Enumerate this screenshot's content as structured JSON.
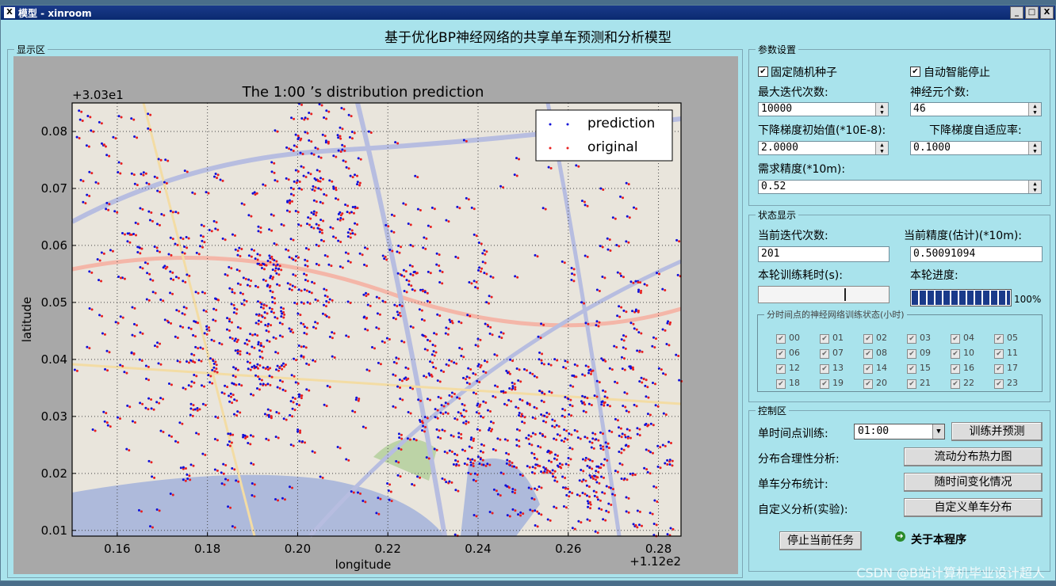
{
  "window": {
    "title": "模型 - xinroom",
    "app_heading": "基于优化BP神经网络的共享单车预测和分析模型",
    "controls": [
      "_",
      "□",
      "X"
    ]
  },
  "display_area": {
    "label": "显示区"
  },
  "chart_data": {
    "type": "scatter",
    "title": "The 1:00 ’s distribution prediction",
    "xlabel": "longitude",
    "ylabel": "latitude",
    "x_offset_label": "+1.12e2",
    "y_offset_label": "+3.03e1",
    "xlim": [
      0.15,
      0.285
    ],
    "ylim": [
      0.009,
      0.085
    ],
    "xticks": [
      "0.16",
      "0.18",
      "0.20",
      "0.22",
      "0.24",
      "0.26",
      "0.28"
    ],
    "yticks": [
      "0.01",
      "0.02",
      "0.03",
      "0.04",
      "0.05",
      "0.06",
      "0.07",
      "0.08"
    ],
    "grid": true,
    "legend_position": "top-right",
    "series": [
      {
        "name": "prediction",
        "color": "#1010d8",
        "marker": "dot"
      },
      {
        "name": "original",
        "color": "#e82020",
        "marker": "dot"
      }
    ],
    "clusters": [
      {
        "x": 0.17,
        "y": 0.05,
        "n": 120,
        "sx": 0.008,
        "sy": 0.015
      },
      {
        "x": 0.193,
        "y": 0.048,
        "n": 200,
        "sx": 0.008,
        "sy": 0.01
      },
      {
        "x": 0.205,
        "y": 0.07,
        "n": 140,
        "sx": 0.007,
        "sy": 0.012
      },
      {
        "x": 0.185,
        "y": 0.03,
        "n": 90,
        "sx": 0.012,
        "sy": 0.008
      },
      {
        "x": 0.225,
        "y": 0.05,
        "n": 90,
        "sx": 0.01,
        "sy": 0.01
      },
      {
        "x": 0.235,
        "y": 0.03,
        "n": 160,
        "sx": 0.012,
        "sy": 0.009
      },
      {
        "x": 0.262,
        "y": 0.022,
        "n": 260,
        "sx": 0.012,
        "sy": 0.01
      },
      {
        "x": 0.275,
        "y": 0.042,
        "n": 90,
        "sx": 0.008,
        "sy": 0.012
      },
      {
        "x": 0.245,
        "y": 0.062,
        "n": 40,
        "sx": 0.015,
        "sy": 0.012
      },
      {
        "x": 0.158,
        "y": 0.07,
        "n": 40,
        "sx": 0.006,
        "sy": 0.012
      }
    ]
  },
  "params": {
    "label": "参数设置",
    "fixed_seed_label": "固定随机种子",
    "auto_stop_label": "自动智能停止",
    "max_iter_label": "最大迭代次数:",
    "max_iter_value": "10000",
    "neurons_label": "神经元个数:",
    "neurons_value": "46",
    "grad_init_label": "下降梯度初始值(*10E-8):",
    "grad_init_value": "2.0000",
    "grad_adapt_label": "下降梯度自适应率:",
    "grad_adapt_value": "0.1000",
    "precision_label": "需求精度(*10m):",
    "precision_value": "0.52"
  },
  "status": {
    "label": "状态显示",
    "iter_label": "当前迭代次数:",
    "iter_value": "201",
    "acc_label": "当前精度(估计)(*10m):",
    "acc_value": "0.50091094",
    "time_label": "本轮训练耗时(s):",
    "progress_label": "本轮进度:",
    "progress_value": 1.0,
    "progress_text": "100%",
    "hours_group_label": "分时间点的神经网络训练状态(小时)",
    "hours": [
      "00",
      "01",
      "02",
      "03",
      "04",
      "05",
      "06",
      "07",
      "08",
      "09",
      "10",
      "11",
      "12",
      "13",
      "14",
      "15",
      "16",
      "17",
      "18",
      "19",
      "20",
      "21",
      "22",
      "23"
    ]
  },
  "control": {
    "label": "控制区",
    "single_label": "单时间点训练:",
    "time_select_value": "01:00",
    "train_btn": "训练并预测",
    "dist_label": "分布合理性分析:",
    "heat_btn": "流动分布热力图",
    "stat_label": "单车分布统计:",
    "time_change_btn": "随时间变化情况",
    "custom_label": "自定义分析(实验):",
    "custom_btn": "自定义单车分布",
    "stop_btn": "停止当前任务",
    "about_label": "关于本程序"
  },
  "watermark": "CSDN @B站计算机毕业设计超人"
}
